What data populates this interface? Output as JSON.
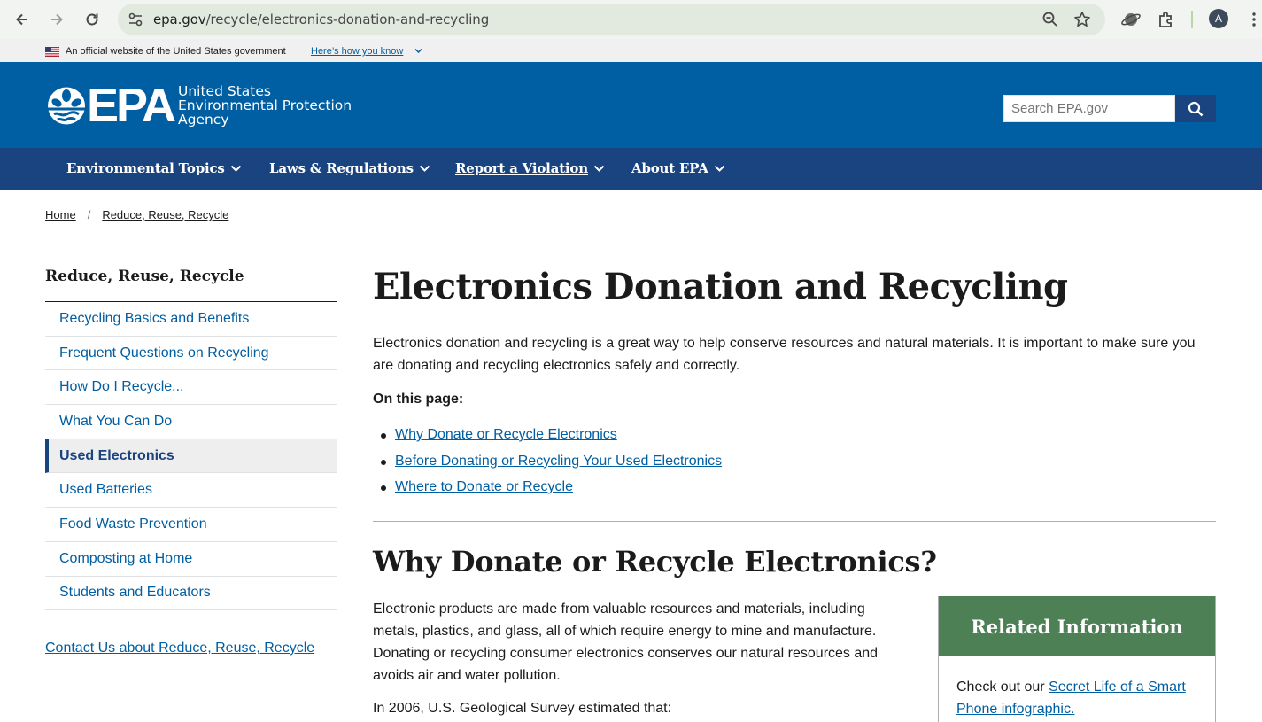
{
  "browser": {
    "url_host": "epa.gov",
    "url_path": "/recycle/electronics-donation-and-recycling",
    "avatar_letter": "A"
  },
  "gov_banner": {
    "text": "An official website of the United States government",
    "link": "Here’s how you know"
  },
  "header": {
    "logo_text": "EPA",
    "agency_line1": "United States",
    "agency_line2": "Environmental Protection",
    "agency_line3": "Agency",
    "search_placeholder": "Search EPA.gov"
  },
  "mainnav": {
    "items": [
      {
        "label": "Environmental Topics"
      },
      {
        "label": "Laws & Regulations"
      },
      {
        "label": "Report a Violation"
      },
      {
        "label": "About EPA"
      }
    ]
  },
  "breadcrumb": {
    "home": "Home",
    "separator": "/",
    "current": "Reduce, Reuse, Recycle"
  },
  "sidenav": {
    "title": "Reduce, Reuse, Recycle",
    "items": [
      {
        "label": "Recycling Basics and Benefits"
      },
      {
        "label": "Frequent Questions on Recycling"
      },
      {
        "label": "How Do I Recycle..."
      },
      {
        "label": "What You Can Do"
      },
      {
        "label": "Used Electronics"
      },
      {
        "label": "Used Batteries"
      },
      {
        "label": "Food Waste Prevention"
      },
      {
        "label": "Composting at Home"
      },
      {
        "label": "Students and Educators"
      }
    ],
    "contact_link": "Contact Us about Reduce, Reuse, Recycle"
  },
  "main": {
    "title": "Electronics Donation and Recycling",
    "intro": "Electronics donation and recycling is a great way to help conserve resources and natural materials. It is important to make sure you are donating and recycling electronics safely and correctly.",
    "on_this_page": "On this page:",
    "toc": [
      {
        "label": "Why Donate or Recycle Electronics"
      },
      {
        "label": "Before Donating or Recycling Your Used Electronics"
      },
      {
        "label": "Where to Donate or Recycle"
      }
    ],
    "section_title": "Why Donate or Recycle Electronics?",
    "section_p": "Electronic products are made from valuable resources and materials, including metals, plastics, and glass, all of which require energy to mine and manufacture. Donating or recycling consumer electronics conserves our natural resources and avoids air and water pollution.",
    "section_p2": "In 2006, U.S. Geological Survey estimated that:"
  },
  "related": {
    "title": "Related Information",
    "text_before": "Check out our ",
    "link": "Secret Life of a Smart Phone infographic."
  },
  "colors": {
    "header_blue": "#005ea2",
    "nav_blue": "#1a4480",
    "link_blue": "#005ea2",
    "related_green": "#4d8055"
  }
}
